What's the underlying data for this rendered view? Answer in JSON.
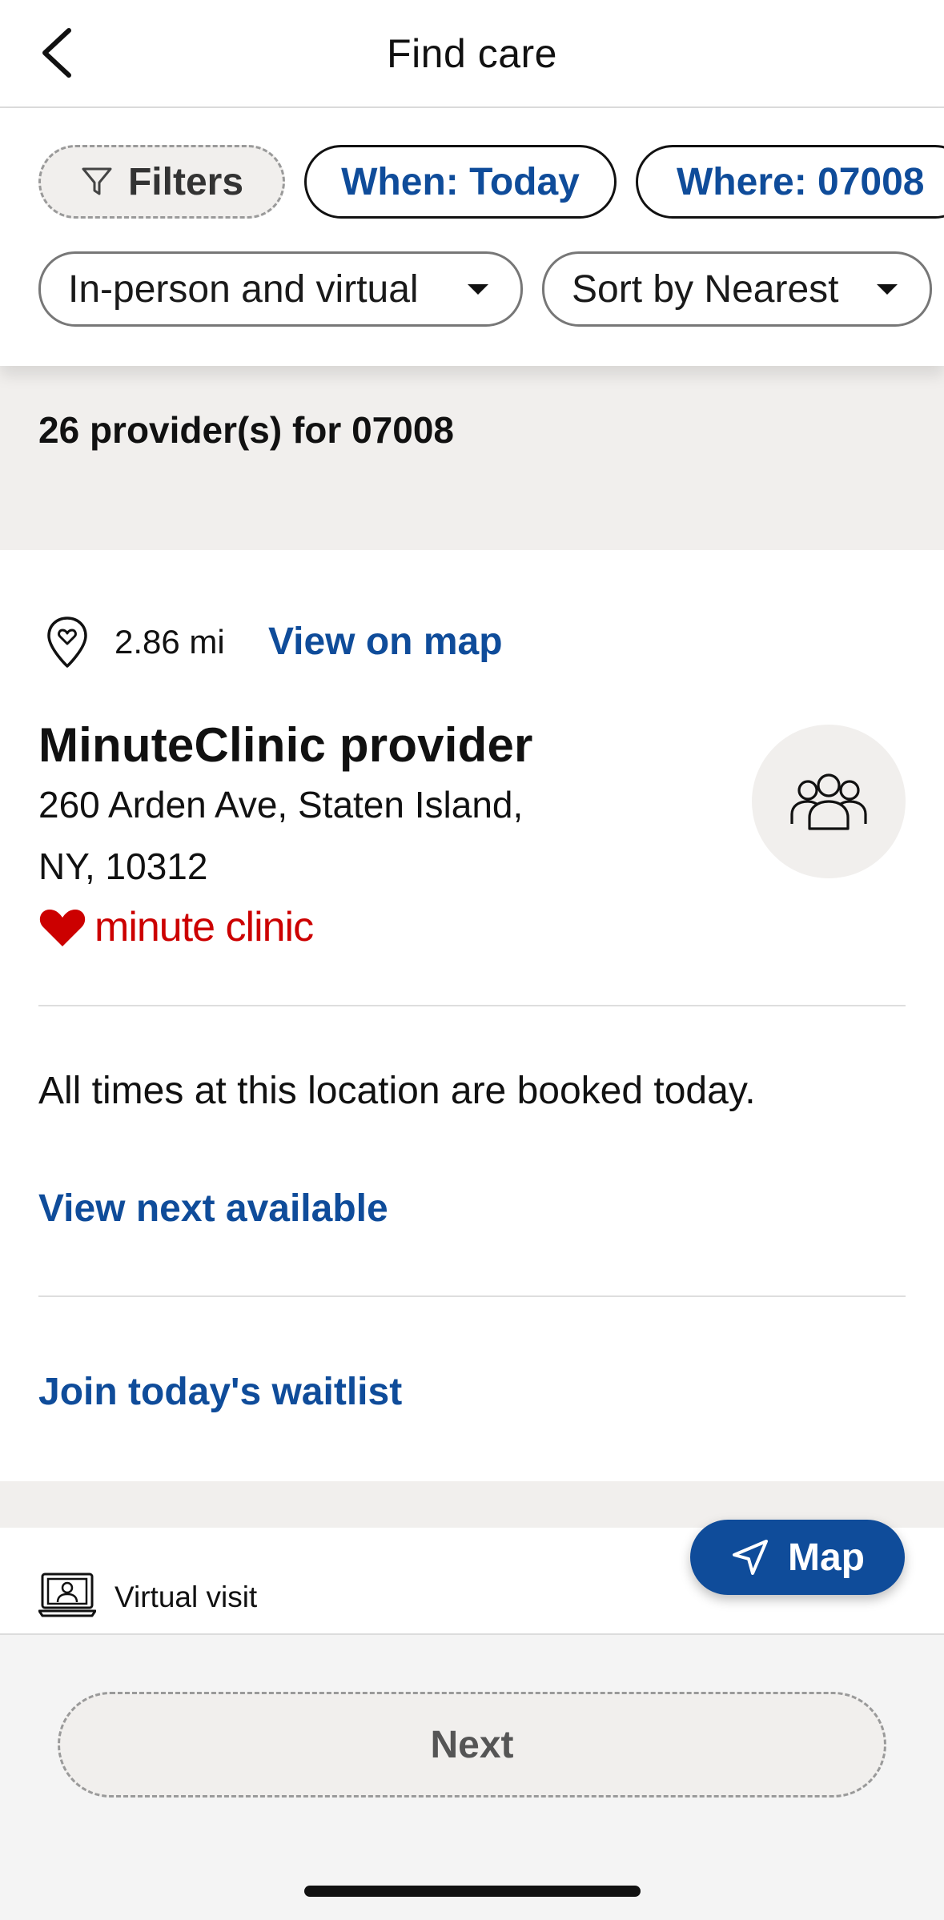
{
  "header": {
    "title": "Find care",
    "back_icon": "chevron-left-icon"
  },
  "filters": {
    "filters_label": "Filters",
    "when_label": "When: Today",
    "where_label": "Where: 07008",
    "visit_type": "In-person and virtual",
    "sort": "Sort by Nearest"
  },
  "results": {
    "count_text": "26 provider(s) for 07008"
  },
  "card": {
    "distance": "2.86 mi",
    "view_on_map": "View on map",
    "provider_name": "MinuteClinic provider",
    "address_line1": "260 Arden Ave, Staten Island,",
    "address_line2": "NY, 10312",
    "logo_text": "minute clinic",
    "booked_message": "All times at this location are booked today.",
    "next_available": "View next available",
    "waitlist": "Join today's waitlist"
  },
  "next_card": {
    "visit_type": "Virtual visit"
  },
  "map_button": {
    "label": "Map"
  },
  "footer": {
    "next_label": "Next"
  },
  "colors": {
    "accent": "#0f4c9a",
    "brand_red": "#cc0000",
    "band_bg": "#f1efed"
  }
}
